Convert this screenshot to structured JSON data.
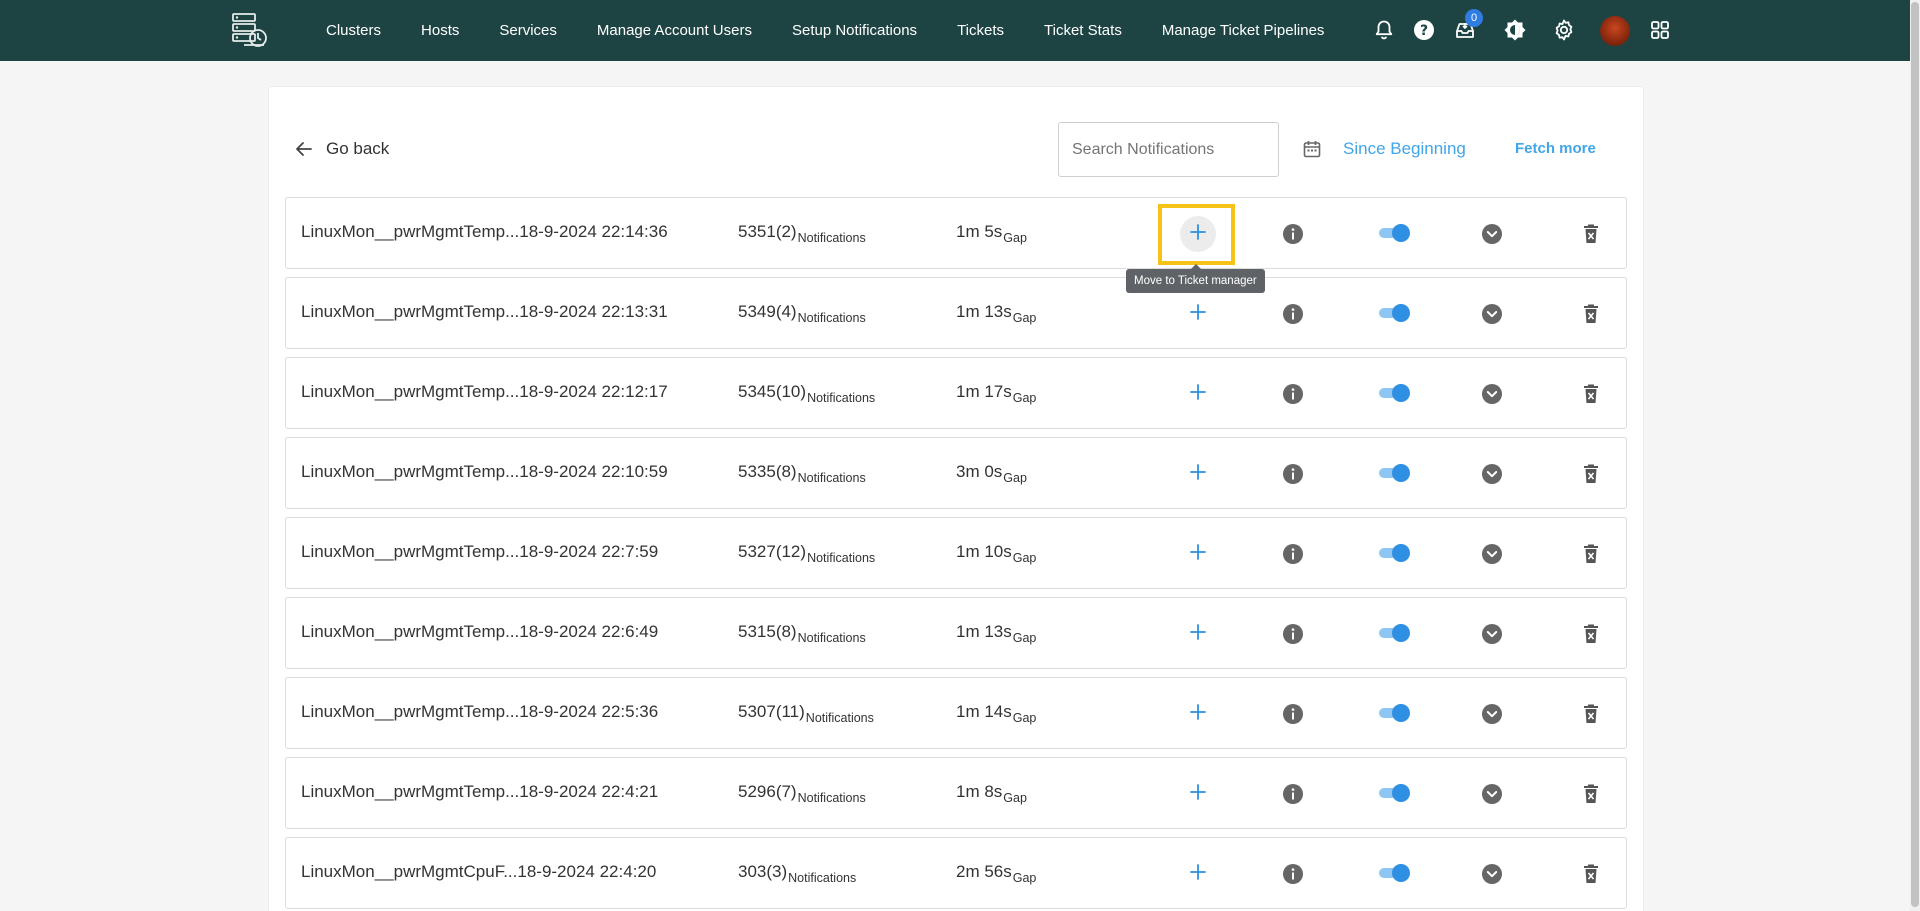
{
  "nav": {
    "items": [
      "Clusters",
      "Hosts",
      "Services",
      "Manage Account Users",
      "Setup Notifications",
      "Tickets",
      "Ticket Stats",
      "Manage Ticket Pipelines"
    ],
    "inbox_count": "0",
    "icons": [
      "bell-icon",
      "help-icon",
      "inbox-icon",
      "theme-icon",
      "gear-icon",
      "avatar",
      "apps-grid-icon"
    ]
  },
  "toolbar": {
    "go_back": "Go back",
    "search_placeholder": "Search Notifications",
    "since": "Since Beginning",
    "fetch_more": "Fetch more"
  },
  "tooltip": "Move to Ticket manager",
  "colors": {
    "nav_bg": "#1d4443",
    "accent": "#42a5e8",
    "toggle_on": "#2f8fe3",
    "highlight": "#f5c318"
  },
  "notifications": [
    {
      "name": "LinuxMon__pwrMgmtTemp...",
      "time": "18-9-2024 22:14:36",
      "count": "5351(2)",
      "count_label": "Notifications",
      "gap": "1m 5s",
      "gap_label": "Gap",
      "enabled": true
    },
    {
      "name": "LinuxMon__pwrMgmtTemp...",
      "time": "18-9-2024 22:13:31",
      "count": "5349(4)",
      "count_label": "Notifications",
      "gap": "1m 13s",
      "gap_label": "Gap",
      "enabled": true
    },
    {
      "name": "LinuxMon__pwrMgmtTemp...",
      "time": "18-9-2024 22:12:17",
      "count": "5345(10)",
      "count_label": "Notifications",
      "gap": "1m 17s",
      "gap_label": "Gap",
      "enabled": true
    },
    {
      "name": "LinuxMon__pwrMgmtTemp...",
      "time": "18-9-2024 22:10:59",
      "count": "5335(8)",
      "count_label": "Notifications",
      "gap": "3m 0s",
      "gap_label": "Gap",
      "enabled": true
    },
    {
      "name": "LinuxMon__pwrMgmtTemp...",
      "time": "18-9-2024 22:7:59",
      "count": "5327(12)",
      "count_label": "Notifications",
      "gap": "1m 10s",
      "gap_label": "Gap",
      "enabled": true
    },
    {
      "name": "LinuxMon__pwrMgmtTemp...",
      "time": "18-9-2024 22:6:49",
      "count": "5315(8)",
      "count_label": "Notifications",
      "gap": "1m 13s",
      "gap_label": "Gap",
      "enabled": true
    },
    {
      "name": "LinuxMon__pwrMgmtTemp...",
      "time": "18-9-2024 22:5:36",
      "count": "5307(11)",
      "count_label": "Notifications",
      "gap": "1m 14s",
      "gap_label": "Gap",
      "enabled": true
    },
    {
      "name": "LinuxMon__pwrMgmtTemp...",
      "time": "18-9-2024 22:4:21",
      "count": "5296(7)",
      "count_label": "Notifications",
      "gap": "1m 8s",
      "gap_label": "Gap",
      "enabled": true
    },
    {
      "name": "LinuxMon__pwrMgmtCpuF...",
      "time": "18-9-2024 22:4:20",
      "count": "303(3)",
      "count_label": "Notifications",
      "gap": "2m 56s",
      "gap_label": "Gap",
      "enabled": true
    }
  ]
}
